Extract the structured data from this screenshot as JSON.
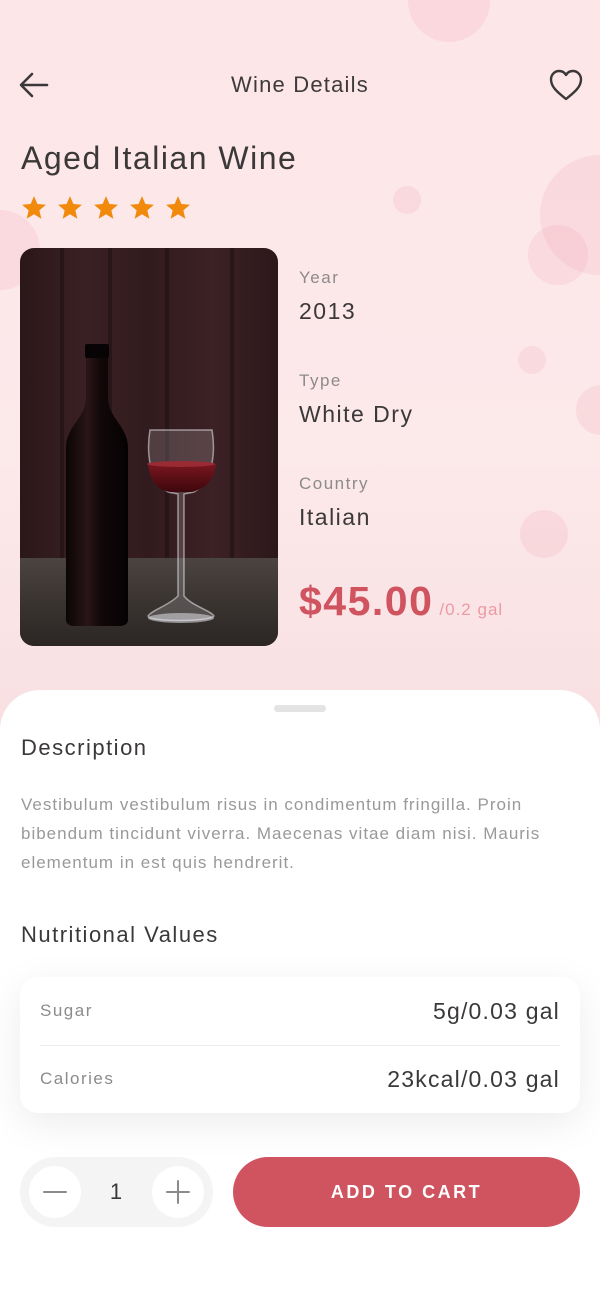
{
  "header": {
    "title": "Wine Details",
    "back_icon": "arrow-left-icon",
    "favorite_icon": "heart-outline-icon"
  },
  "product": {
    "name": "Aged Italian Wine",
    "rating": 5,
    "rating_max": 5,
    "image": "wine-bottle-and-glass-photo",
    "specs": {
      "year_label": "Year",
      "year_value": "2013",
      "type_label": "Type",
      "type_value": "White Dry",
      "country_label": "Country",
      "country_value": "Italian"
    },
    "price": "$45.00",
    "price_unit": "/0.2 gal"
  },
  "description": {
    "title": "Description",
    "text": "Vestibulum vestibulum risus in condimentum fringilla. Proin bibendum tincidunt viverra. Maecenas vitae diam nisi. Mauris elementum in est quis hendrerit."
  },
  "nutrition": {
    "title": "Nutritional Values",
    "rows": [
      {
        "label": "Sugar",
        "value": "5g/0.03 gal"
      },
      {
        "label": "Calories",
        "value": "23kcal/0.03 gal"
      }
    ]
  },
  "cart": {
    "quantity": "1",
    "minus_icon": "minus-icon",
    "plus_icon": "plus-icon",
    "add_label": "ADD TO CART"
  },
  "colors": {
    "accent": "#d0545f",
    "star": "#f18a0c",
    "background_top": "#fde6e8"
  }
}
